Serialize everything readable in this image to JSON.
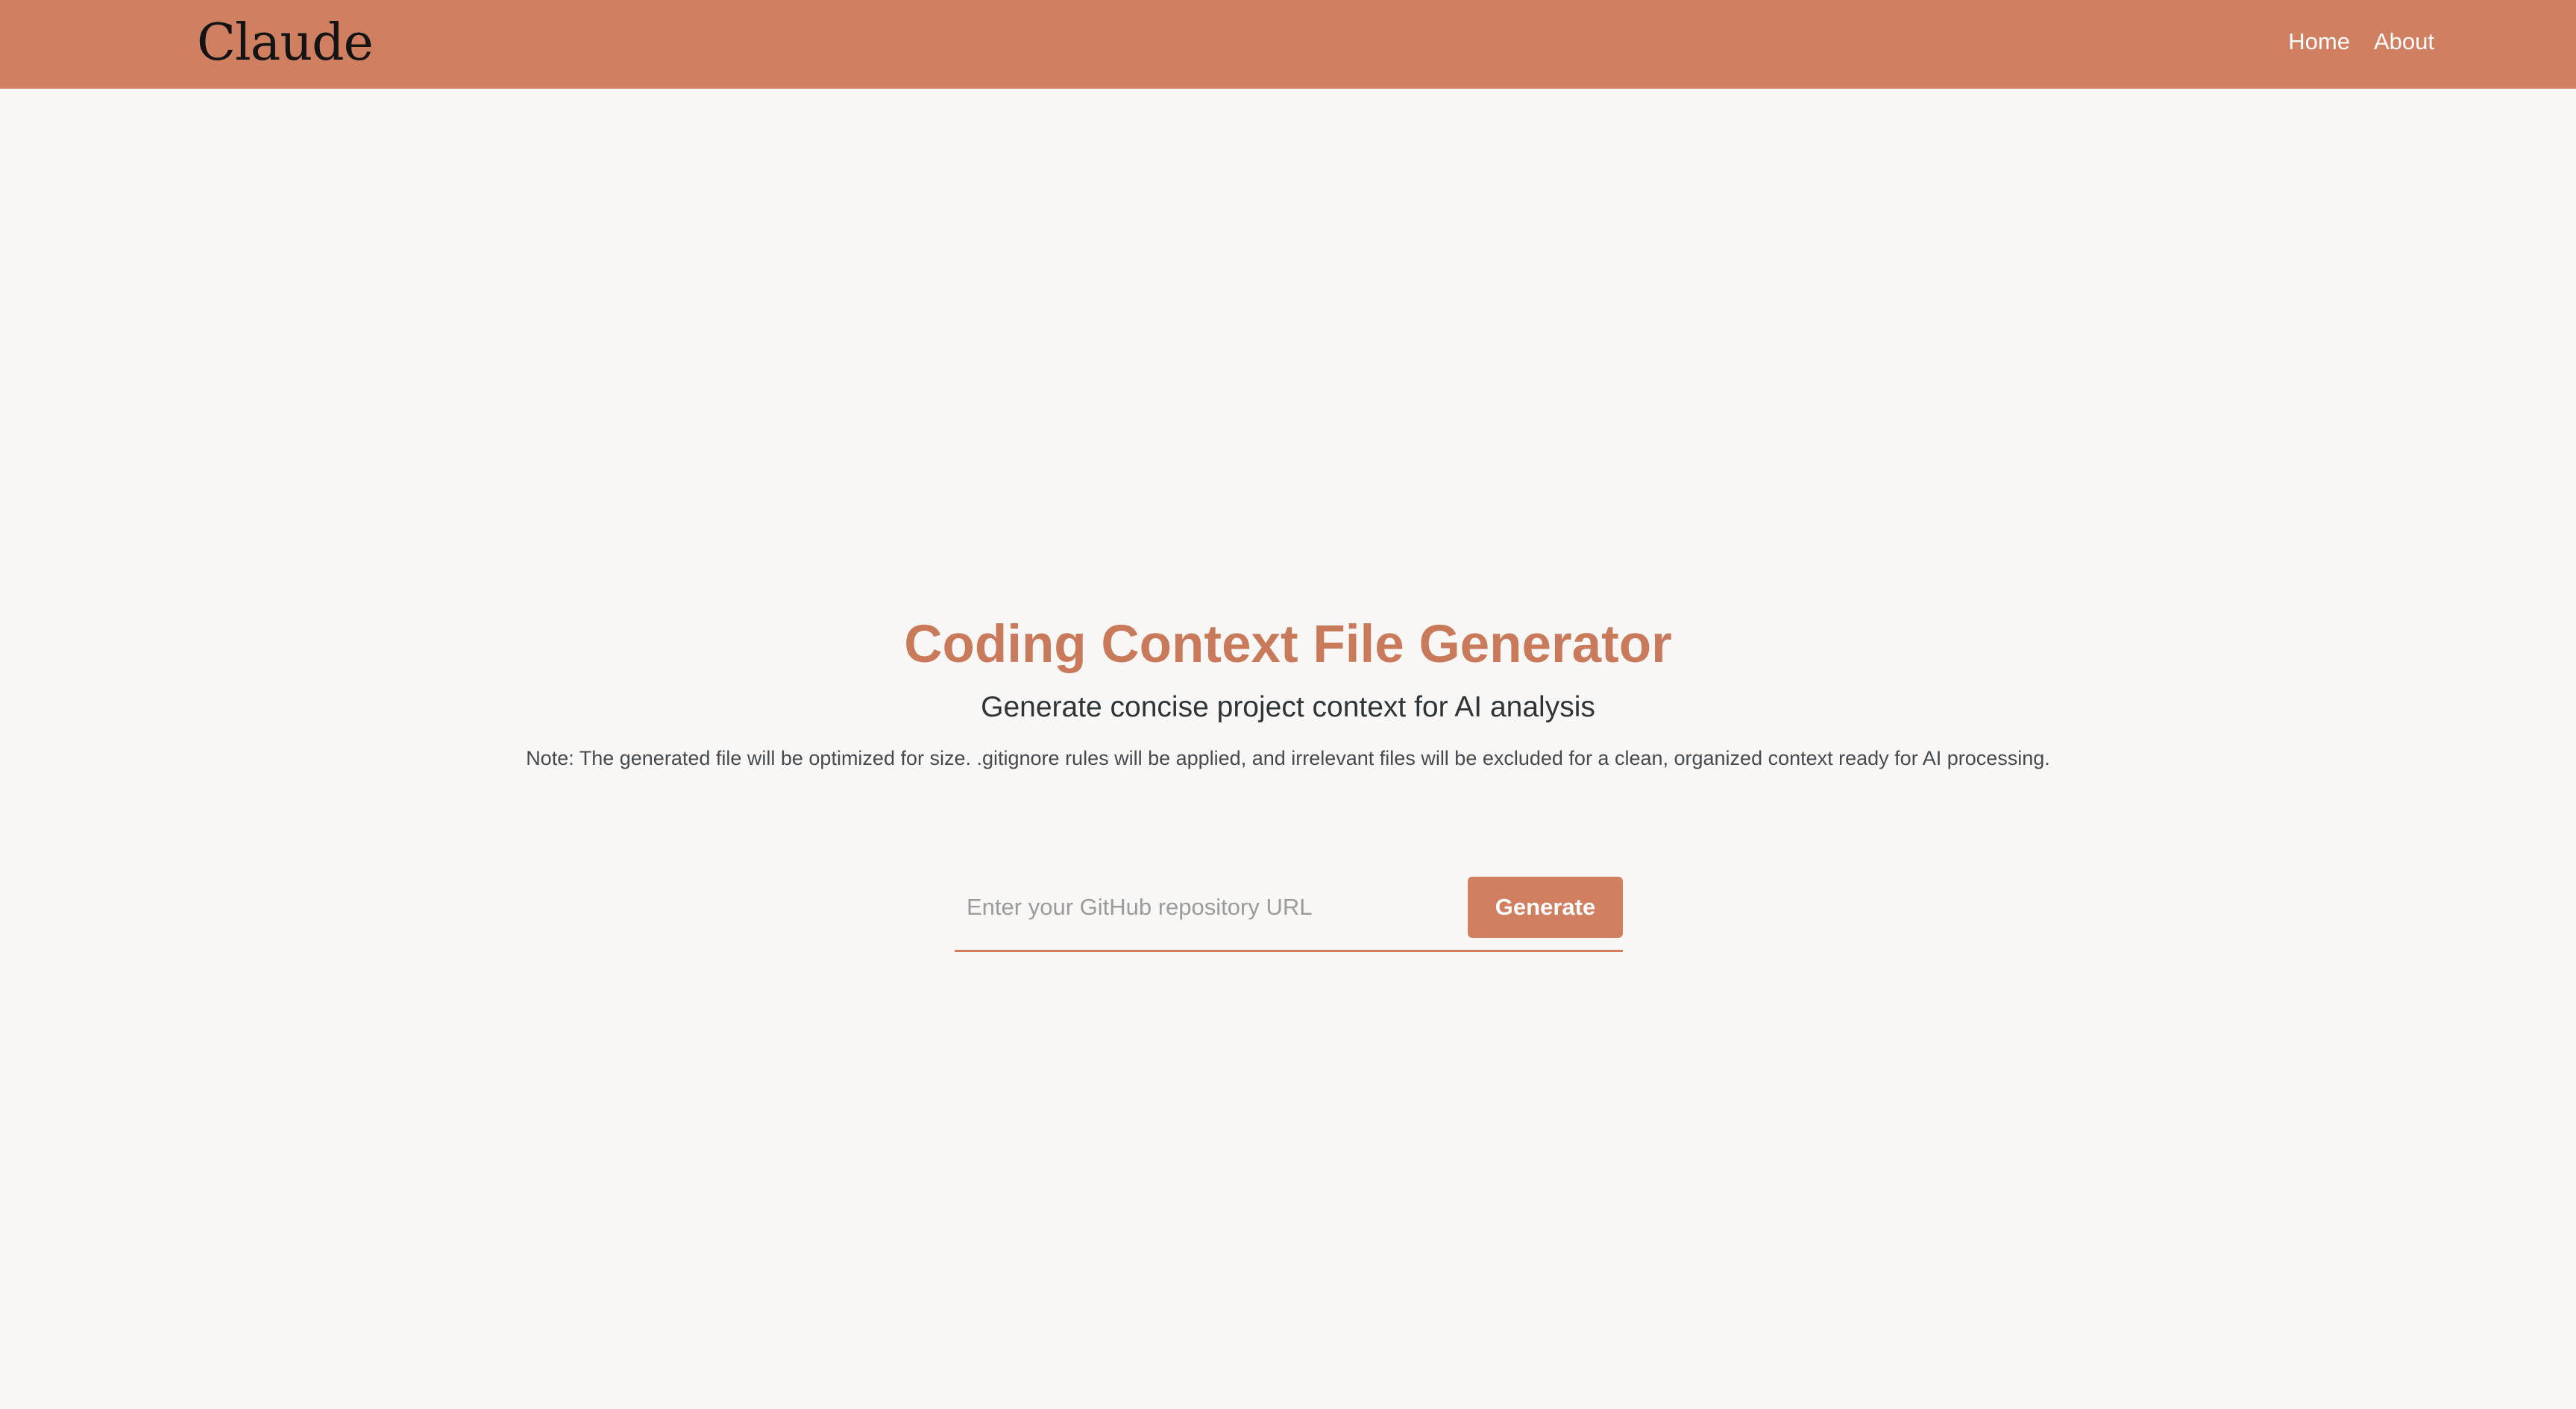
{
  "header": {
    "logo_text": "Claude",
    "nav": [
      {
        "label": "Home"
      },
      {
        "label": "About"
      }
    ]
  },
  "hero": {
    "title": "Coding Context File Generator",
    "subtitle": "Generate concise project context for AI analysis",
    "note": "Note: The generated file will be optimized for size. .gitignore rules will be applied, and irrelevant files will be excluded for a clean, organized context ready for AI processing."
  },
  "form": {
    "url_placeholder": "Enter your GitHub repository URL",
    "url_value": "",
    "generate_label": "Generate"
  },
  "colors": {
    "accent": "#d07f60",
    "title": "#c97a5b",
    "background": "#f8f7f6"
  }
}
